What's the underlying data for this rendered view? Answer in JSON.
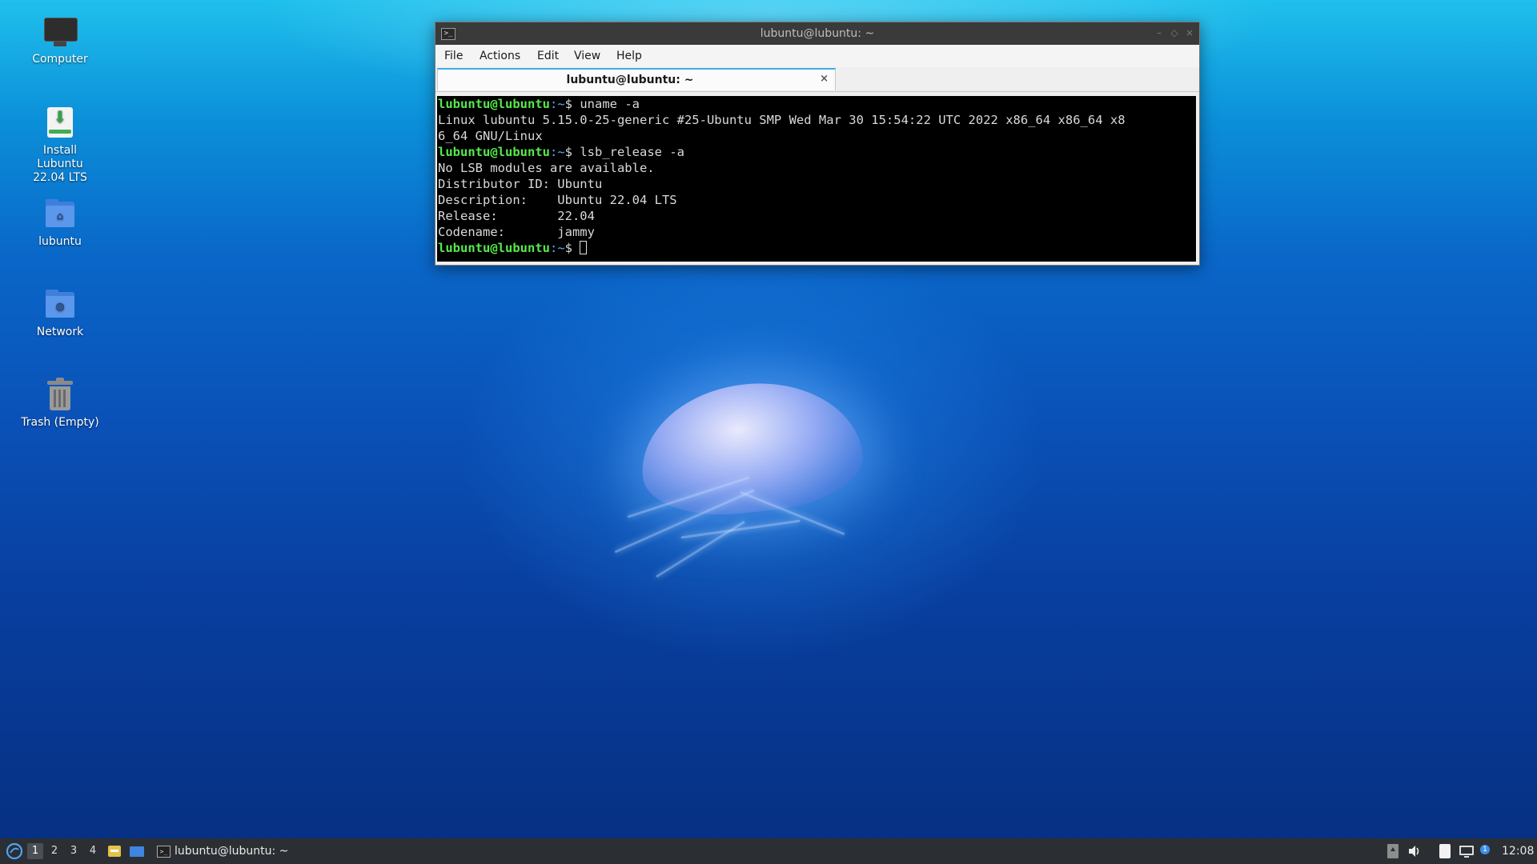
{
  "window": {
    "title": "lubuntu@lubuntu: ~",
    "menu": [
      "File",
      "Actions",
      "Edit",
      "View",
      "Help"
    ],
    "tab_label": "lubuntu@lubuntu: ~",
    "tab_close": "×",
    "controls": {
      "minimize": "–",
      "maximize": "◇",
      "close": "×"
    }
  },
  "terminal": {
    "prompt_user": "lubuntu@lubuntu",
    "prompt_path": ":~",
    "prompt_symbol": "$",
    "cmd1": " uname -a",
    "out1a": "Linux lubuntu 5.15.0-25-generic #25-Ubuntu SMP Wed Mar 30 15:54:22 UTC 2022 x86_64 x86_64 x8",
    "out1b": "6_64 GNU/Linux",
    "cmd2": " lsb_release -a",
    "out2": [
      "No LSB modules are available.",
      "Distributor ID: Ubuntu",
      "Description:    Ubuntu 22.04 LTS",
      "Release:        22.04",
      "Codename:       jammy"
    ]
  },
  "desktop_icons": {
    "computer": "Computer",
    "install": "Install Lubuntu 22.04 LTS",
    "home": "lubuntu",
    "network": "Network",
    "trash": "Trash (Empty)"
  },
  "taskbar": {
    "workspaces": [
      "1",
      "2",
      "3",
      "4"
    ],
    "active_workspace": "1",
    "task_label": "lubuntu@lubuntu: ~",
    "clock": "12:08",
    "notification_count": "1"
  },
  "colors": {
    "prompt_user": "#55e84c",
    "prompt_path": "#5fa8ff",
    "tab_accent": "#3daee9",
    "taskbar_bg": "#2b2f33"
  }
}
